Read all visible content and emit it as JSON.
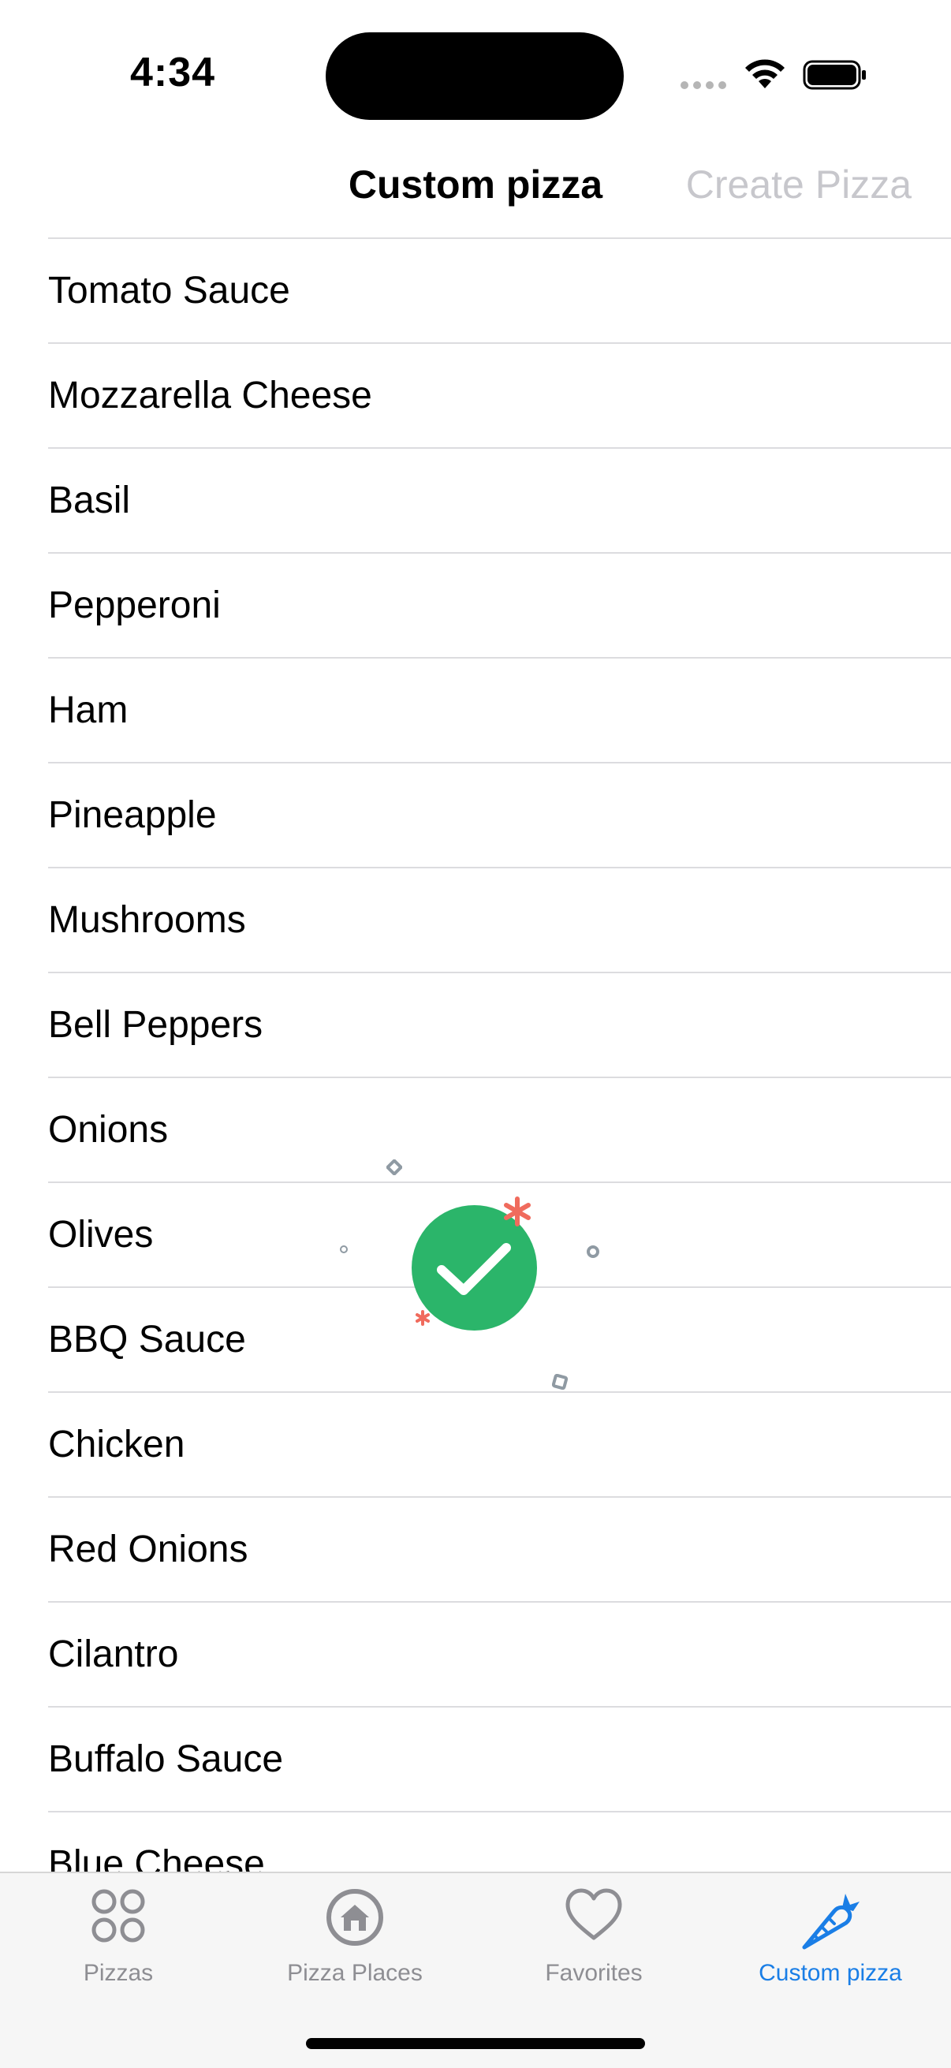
{
  "status_bar": {
    "time": "4:34"
  },
  "nav": {
    "title": "Custom pizza",
    "action": "Create Pizza"
  },
  "ingredients": [
    {
      "label": "Tomato Sauce"
    },
    {
      "label": "Mozzarella Cheese"
    },
    {
      "label": "Basil"
    },
    {
      "label": "Pepperoni"
    },
    {
      "label": "Ham"
    },
    {
      "label": "Pineapple"
    },
    {
      "label": "Mushrooms"
    },
    {
      "label": "Bell Peppers"
    },
    {
      "label": "Onions"
    },
    {
      "label": "Olives"
    },
    {
      "label": "BBQ Sauce"
    },
    {
      "label": "Chicken"
    },
    {
      "label": "Red Onions"
    },
    {
      "label": "Cilantro"
    },
    {
      "label": "Buffalo Sauce"
    },
    {
      "label": "Blue Cheese"
    }
  ],
  "tab_bar": {
    "tabs": [
      {
        "label": "Pizzas",
        "icon": "grid-circles-icon",
        "active": false
      },
      {
        "label": "Pizza Places",
        "icon": "home-circle-icon",
        "active": false
      },
      {
        "label": "Favorites",
        "icon": "heart-icon",
        "active": false
      },
      {
        "label": "Custom pizza",
        "icon": "carrot-icon",
        "active": true
      }
    ]
  },
  "colors": {
    "accent": "#1a7ee6",
    "success": "#2bb56a",
    "confetti_red": "#f06b5d",
    "confetti_gray": "#8f9aa3",
    "disabled": "#c7c7cc",
    "inactive_tab": "#8e8e93"
  }
}
